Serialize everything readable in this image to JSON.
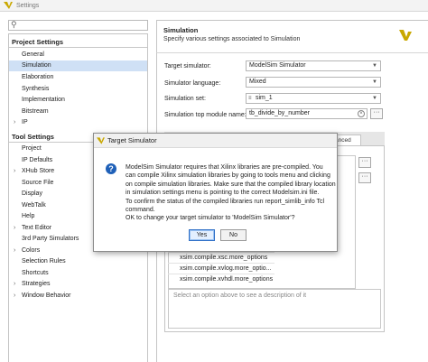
{
  "window": {
    "title": "Settings",
    "logo_icon": "vivado-logo-icon",
    "accent": "#c9a800"
  },
  "sidebar": {
    "search_icon": "search-icon",
    "sections": [
      {
        "label": "Project Settings",
        "items": [
          {
            "label": "General"
          },
          {
            "label": "Simulation",
            "selected": true
          },
          {
            "label": "Elaboration"
          },
          {
            "label": "Synthesis"
          },
          {
            "label": "Implementation"
          },
          {
            "label": "Bitstream"
          },
          {
            "label": "IP",
            "expandable": true
          }
        ]
      },
      {
        "label": "Tool Settings",
        "items": [
          {
            "label": "Project"
          },
          {
            "label": "IP Defaults"
          },
          {
            "label": "XHub Store",
            "expandable": true
          },
          {
            "label": "Source File"
          },
          {
            "label": "Display"
          },
          {
            "label": "WebTalk"
          },
          {
            "label": "Help"
          },
          {
            "label": "Text Editor",
            "expandable": true
          },
          {
            "label": "3rd Party Simulators"
          },
          {
            "label": "Colors",
            "expandable": true
          },
          {
            "label": "Selection Rules"
          },
          {
            "label": "Shortcuts"
          },
          {
            "label": "Strategies",
            "expandable": true
          },
          {
            "label": "Window Behavior",
            "expandable": true
          }
        ]
      }
    ]
  },
  "main": {
    "title": "Simulation",
    "subtitle": "Specify various settings associated to Simulation",
    "form": {
      "target_simulator_label": "Target simulator:",
      "target_simulator_value": "ModelSim Simulator",
      "language_label": "Simulator language:",
      "language_value": "Mixed",
      "simset_label": "Simulation set:",
      "simset_value": "sim_1",
      "top_module_label": "Simulation top module name:",
      "top_module_value": "tb_divide_by_number",
      "more_label": "···"
    },
    "tabs": {
      "advanced_partial": "anced"
    },
    "options": [
      "xsim.compile.xsc.more_options",
      "xsim.compile.xvlog.more_optio...",
      "xsim.compile.xvhdl.more_options"
    ],
    "description_placeholder": "Select an option above to see a description of it"
  },
  "dialog": {
    "title": "Target Simulator",
    "icon": "question-icon",
    "message_lines": [
      "ModelSim Simulator requires that Xilinx libraries are pre-compiled. You",
      "can compile Xilinx simulation libraries by going to tools menu and clicking",
      "on compile simulation libraries. Make sure that the compiled library location",
      "in simulation settings menu is pointing to the correct Modelsim.ini file.",
      "To confirm the status of the compiled libraries run report_simlib_info Tcl",
      "command.",
      "OK to change your target simulator to 'ModelSim Simulator'?"
    ],
    "yes_label": "Yes",
    "no_label": "No"
  }
}
